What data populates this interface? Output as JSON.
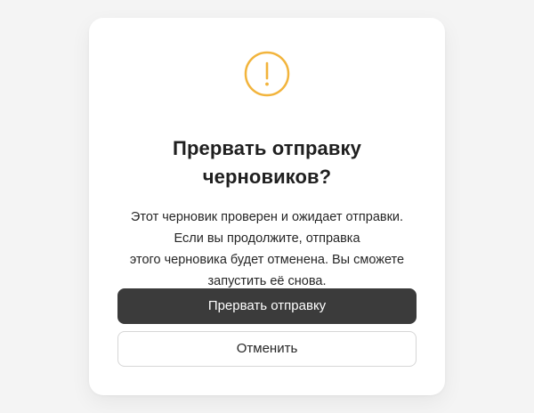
{
  "dialog": {
    "icon": "warning-exclamation-icon",
    "icon_color": "#f2b43c",
    "title_lines": [
      "Прервать отправку",
      "черновиков?"
    ],
    "message_lines": [
      "Этот черновик проверен и ожидает отправки.",
      "Если вы продолжите, отправка",
      "этого черновика будет отменена. Вы сможете",
      "запустить её снова."
    ],
    "confirm_label": "Прервать отправку",
    "cancel_label": "Отменить"
  },
  "colors": {
    "background": "#f4f4f4",
    "card": "#ffffff",
    "primary_button": "#3b3b3b",
    "secondary_button_border": "#d6d6d6"
  }
}
